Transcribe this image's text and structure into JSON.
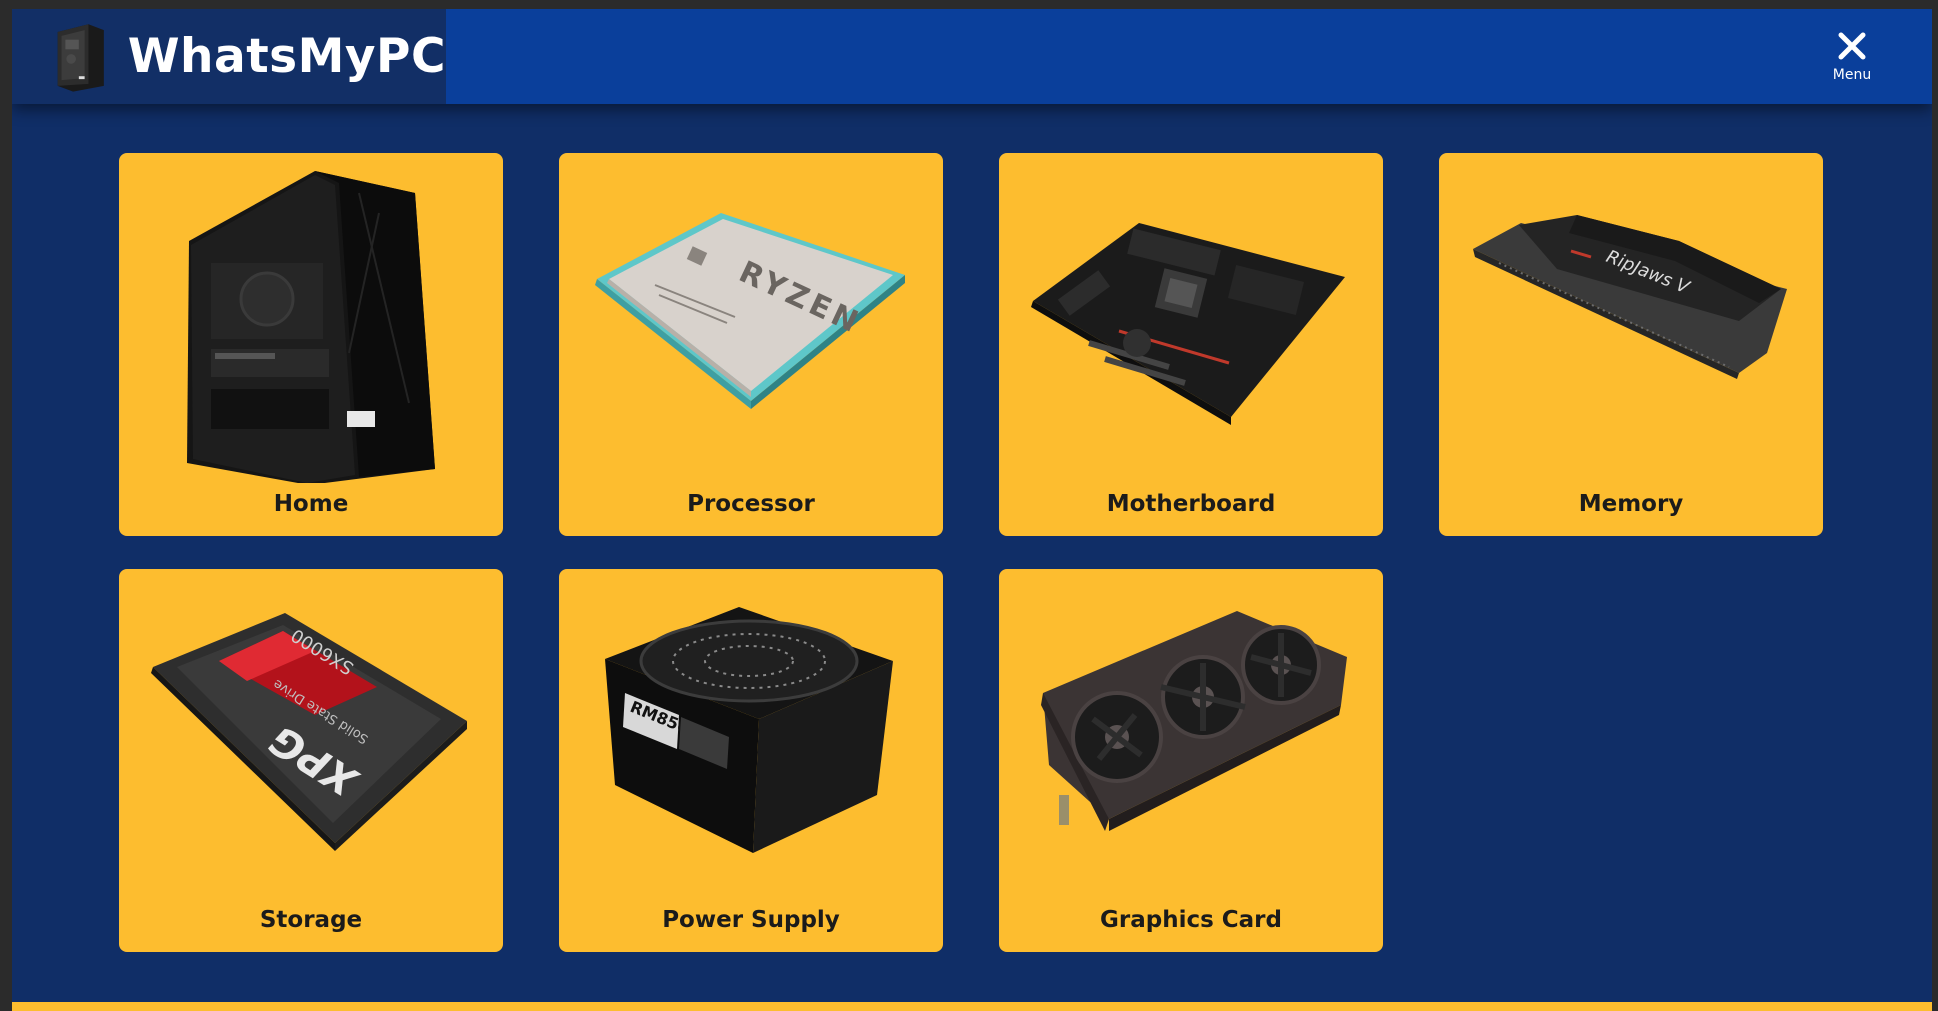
{
  "header": {
    "brand_name": "WhatsMyPC",
    "logo_icon": "pc-tower-icon",
    "menu_icon": "close-icon",
    "menu_label": "Menu"
  },
  "colors": {
    "header_bar": "#0a3f9b",
    "brand_block": "#122f66",
    "page_background": "#102e67",
    "tile_background": "#fdbd2f",
    "tile_text": "#1b1b1b",
    "accent_footer": "#fdbd2f"
  },
  "tiles": [
    {
      "label": "Home",
      "icon": "pc-case-icon"
    },
    {
      "label": "Processor",
      "icon": "cpu-chip-icon"
    },
    {
      "label": "Motherboard",
      "icon": "motherboard-icon"
    },
    {
      "label": "Memory",
      "icon": "ram-stick-icon"
    },
    {
      "label": "Storage",
      "icon": "ssd-drive-icon"
    },
    {
      "label": "Power Supply",
      "icon": "power-supply-icon"
    },
    {
      "label": "Graphics Card",
      "icon": "graphics-card-icon"
    }
  ]
}
